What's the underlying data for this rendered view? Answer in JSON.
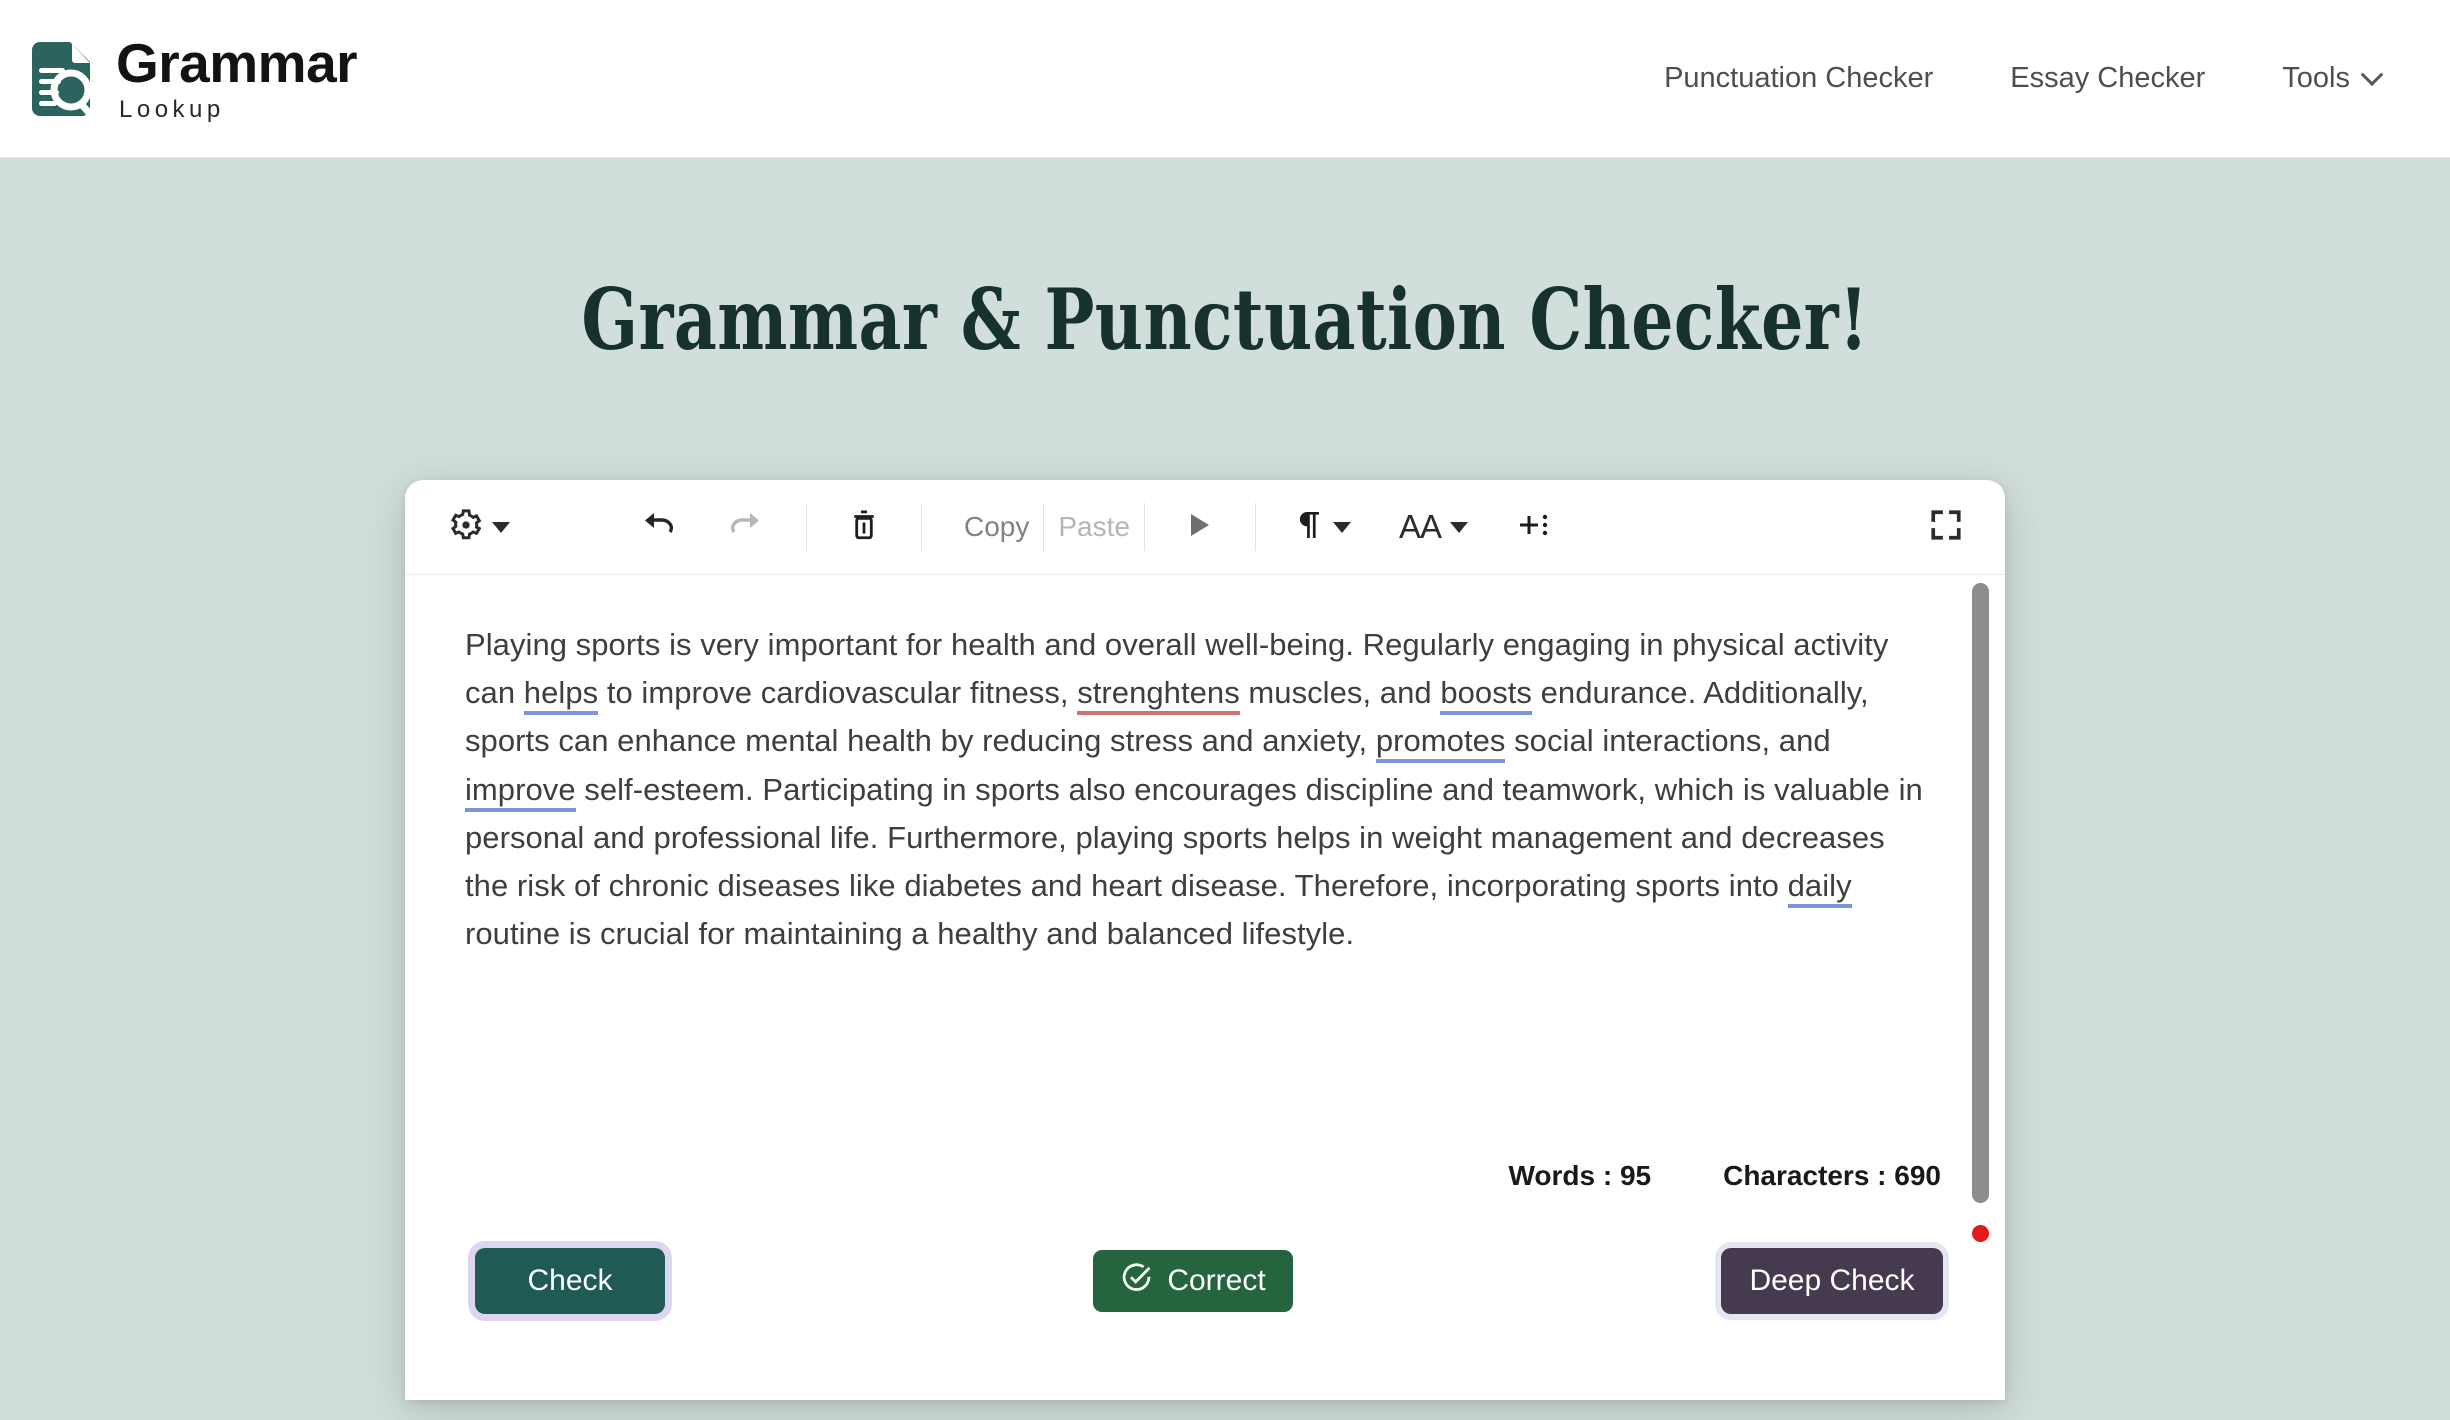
{
  "brand": {
    "title": "Grammar",
    "subtitle": "Lookup",
    "logo_icon": "document-search-icon"
  },
  "nav": {
    "items": [
      {
        "label": "Punctuation Checker",
        "icon": null
      },
      {
        "label": "Essay Checker",
        "icon": null
      },
      {
        "label": "Tools",
        "icon": "chevron-down-icon"
      }
    ]
  },
  "hero": {
    "title": "Grammar & Punctuation Checker!"
  },
  "toolbar": {
    "settings_icon": "gear-icon",
    "settings_caret": "caret-down-icon",
    "undo_icon": "undo-arrow-icon",
    "redo_icon": "redo-arrow-icon",
    "delete_icon": "trash-icon",
    "copy_label": "Copy",
    "paste_label": "Paste",
    "play_icon": "play-triangle-icon",
    "paragraph_icon": "pilcrow-icon",
    "font_size_label": "AA",
    "add_icon": "plus-more-icon",
    "fullscreen_icon": "fullscreen-icon"
  },
  "editor": {
    "paragraph_parts": [
      {
        "text": "Playing sports is very important for health and overall well-being. Regularly engaging in physical activity can ",
        "mark": "none"
      },
      {
        "text": "helps",
        "mark": "grammar"
      },
      {
        "text": " to improve cardiovascular fitness, ",
        "mark": "none"
      },
      {
        "text": "strenghtens",
        "mark": "spelling"
      },
      {
        "text": " muscles, and ",
        "mark": "none"
      },
      {
        "text": "boosts",
        "mark": "grammar"
      },
      {
        "text": " endurance. Additionally, sports can enhance mental health by reducing stress and anxiety, ",
        "mark": "none"
      },
      {
        "text": "promotes",
        "mark": "grammar"
      },
      {
        "text": " social interactions, and ",
        "mark": "none"
      },
      {
        "text": "improve",
        "mark": "grammar"
      },
      {
        "text": " self-esteem. Participating in sports also encourages discipline and teamwork, which is valuable in personal and professional life. Furthermore, playing sports helps in weight management and decreases the risk of chronic diseases like diabetes and heart disease. Therefore, incorporating sports into ",
        "mark": "none"
      },
      {
        "text": "daily",
        "mark": "grammar"
      },
      {
        "text": " routine is crucial for maintaining a healthy and balanced lifestyle.",
        "mark": "none"
      }
    ],
    "grammar_underline_color": "#7b95d8",
    "spelling_underline_color": "#d07070",
    "scrollbar_icon": "vertical-scrollbar",
    "status_dot_icon": "red-dot-indicator"
  },
  "counters": {
    "words": "Words : 95",
    "characters": "Characters : 690"
  },
  "actions": {
    "check_label": "Check",
    "correct_label": "Correct",
    "correct_icon": "check-circle-icon",
    "deep_check_label": "Deep Check"
  },
  "colors": {
    "page_background": "#d2dedb",
    "brand_teal": "#2b645f",
    "heading": "#17322c",
    "check_button": "#1f5a55",
    "correct_button": "#24643f",
    "deep_check_button": "#453a4f"
  }
}
